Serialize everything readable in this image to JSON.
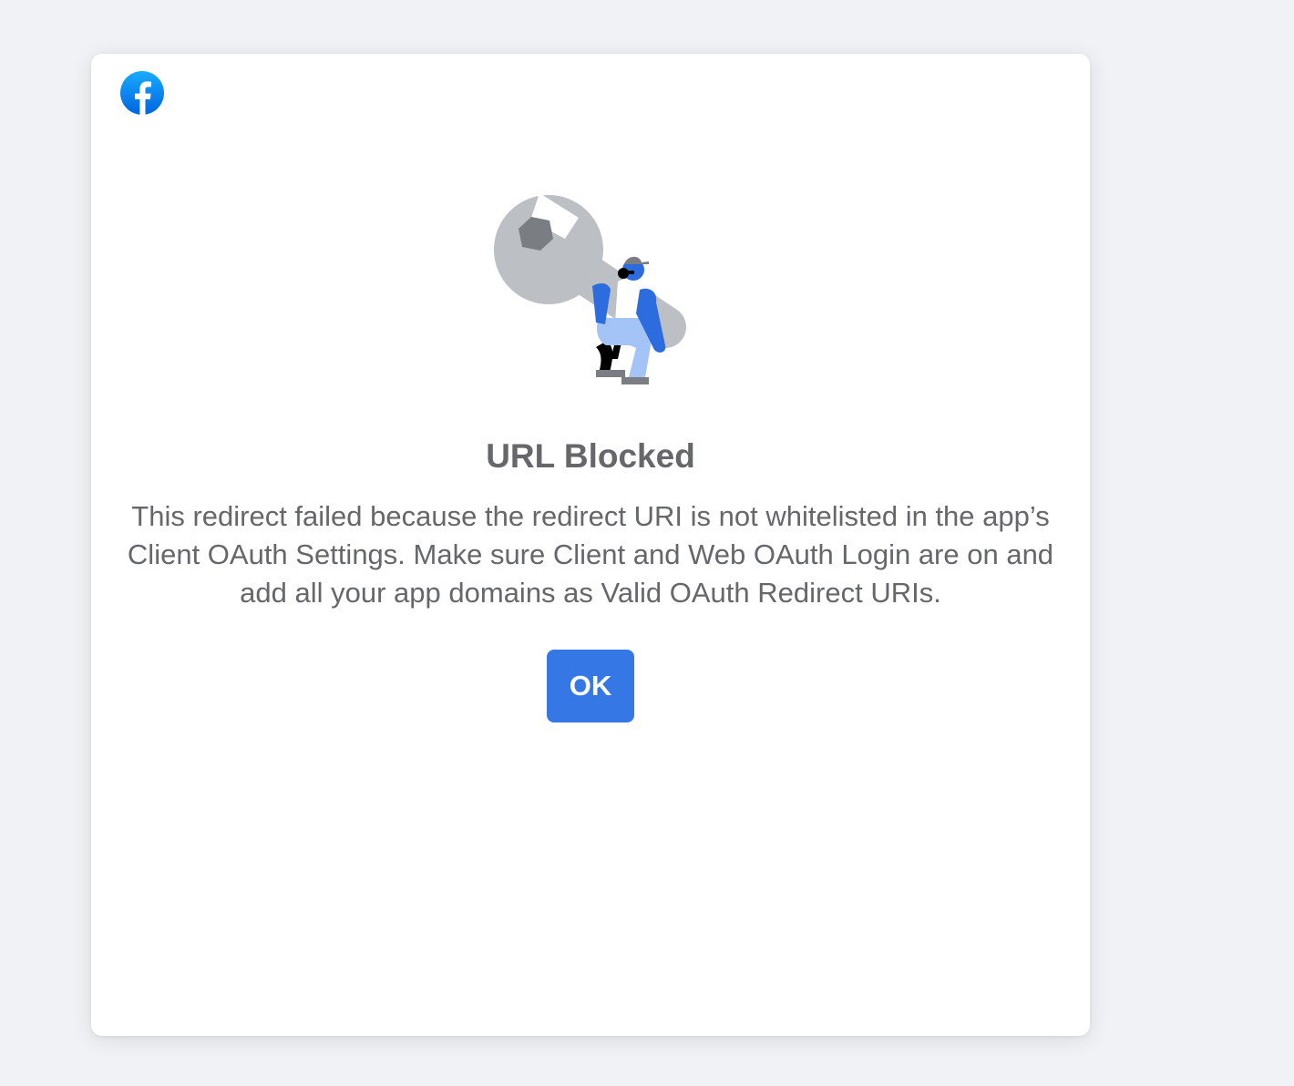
{
  "dialog": {
    "title": "URL Blocked",
    "message": "This redirect failed because the redirect URI is not whitelisted in the app’s Client OAuth Settings. Make sure Client and Web OAuth Login are on and add all your app domains as Valid OAuth Redirect URIs.",
    "ok_label": "OK"
  },
  "icons": {
    "logo": "facebook-logo-icon",
    "illustration": "wrench-worker-illustration"
  },
  "colors": {
    "brand": "#1877f2",
    "button": "#3578e5",
    "text": "#65676b",
    "background": "#f0f2f5"
  }
}
